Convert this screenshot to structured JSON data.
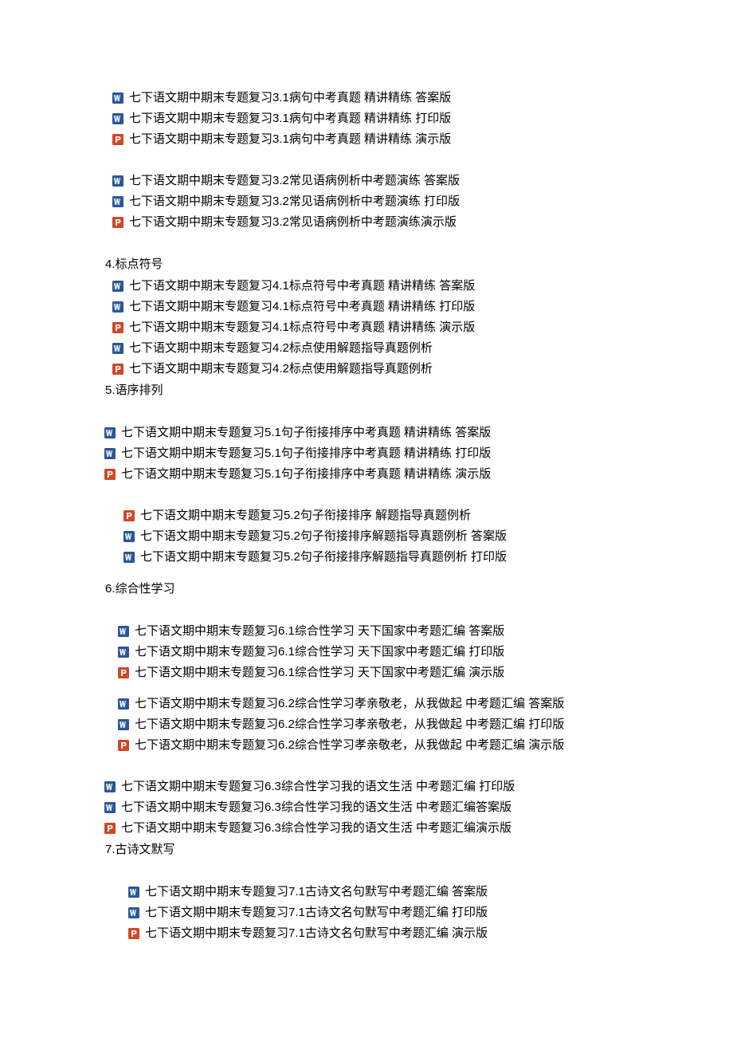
{
  "groups": [
    {
      "heading": null,
      "blocks": [
        {
          "indent": "indent-0",
          "items": [
            {
              "icon": "word",
              "text": "七下语文期中期末专题复习3.1病句中考真题 精讲精练 答案版"
            },
            {
              "icon": "word",
              "text": "七下语文期中期末专题复习3.1病句中考真题 精讲精练 打印版"
            },
            {
              "icon": "ppt",
              "text": "七下语文期中期末专题复习3.1病句中考真题 精讲精练 演示版"
            }
          ]
        },
        {
          "indent": "indent-0",
          "items": [
            {
              "icon": "word",
              "text": "七下语文期中期末专题复习3.2常见语病例析中考题演练 答案版"
            },
            {
              "icon": "word",
              "text": "七下语文期中期末专题复习3.2常见语病例析中考题演练 打印版"
            },
            {
              "icon": "ppt",
              "text": "七下语文期中期末专题复习3.2常见语病例析中考题演练演示版"
            }
          ]
        }
      ]
    },
    {
      "heading": "4.标点符号",
      "heading_indent": "heading-indent",
      "blocks": [
        {
          "indent": "indent-0",
          "items": [
            {
              "icon": "word",
              "text": "七下语文期中期末专题复习4.1标点符号中考真题 精讲精练 答案版"
            },
            {
              "icon": "word",
              "text": "七下语文期中期末专题复习4.1标点符号中考真题 精讲精练 打印版"
            },
            {
              "icon": "ppt",
              "text": "七下语文期中期末专题复习4.1标点符号中考真题 精讲精练 演示版"
            },
            {
              "icon": "word",
              "text": "七下语文期中期末专题复习4.2标点使用解题指导真题例析"
            },
            {
              "icon": "ppt",
              "text": "七下语文期中期末专题复习4.2标点使用解题指导真题例析"
            }
          ],
          "no_spacer_after": true
        }
      ]
    },
    {
      "heading": "5.语序排列",
      "heading_indent": "heading-indent",
      "blocks": [
        {
          "indent": "indent-neg",
          "spacer_before": true,
          "items": [
            {
              "icon": "word",
              "text": "七下语文期中期末专题复习5.1句子衔接排序中考真题 精讲精练 答案版"
            },
            {
              "icon": "word",
              "text": "七下语文期中期末专题复习5.1句子衔接排序中考真题 精讲精练 打印版"
            },
            {
              "icon": "ppt",
              "text": "七下语文期中期末专题复习5.1句子衔接排序中考真题 精讲精练 演示版"
            }
          ]
        },
        {
          "indent": "indent-2",
          "items": [
            {
              "icon": "ppt",
              "text": "七下语文期中期末专题复习5.2句子衔接排序 解题指导真题例析"
            },
            {
              "icon": "word",
              "text": "七下语文期中期末专题复习5.2句子衔接排序解题指导真题例析 答案版"
            },
            {
              "icon": "word",
              "text": "七下语文期中期末专题复习5.2句子衔接排序解题指导真题例析 打印版"
            }
          ],
          "spacer_after_small": true
        }
      ]
    },
    {
      "heading": "6.综合性学习",
      "heading_indent": "heading-indent",
      "blocks": [
        {
          "indent": "indent-1",
          "spacer_before": true,
          "items": [
            {
              "icon": "word",
              "text": "七下语文期中期末专题复习6.1综合性学习 天下国家中考题汇编 答案版"
            },
            {
              "icon": "word",
              "text": "七下语文期中期末专题复习6.1综合性学习 天下国家中考题汇编 打印版"
            },
            {
              "icon": "ppt",
              "text": "七下语文期中期末专题复习6.1综合性学习 天下国家中考题汇编 演示版"
            }
          ],
          "spacer_after_small": true
        },
        {
          "indent": "indent-1",
          "items": [
            {
              "icon": "word",
              "text": "七下语文期中期末专题复习6.2综合性学习孝亲敬老，从我做起 中考题汇编 答案版"
            },
            {
              "icon": "word",
              "text": "七下语文期中期末专题复习6.2综合性学习孝亲敬老，从我做起 中考题汇编 打印版"
            },
            {
              "icon": "ppt",
              "text": "七下语文期中期末专题复习6.2综合性学习孝亲敬老，从我做起 中考题汇编 演示版"
            }
          ]
        },
        {
          "indent": "indent-neg",
          "items": [
            {
              "icon": "word",
              "text": "七下语文期中期末专题复习6.3综合性学习我的语文生活 中考题汇编 打印版"
            },
            {
              "icon": "word",
              "text": "七下语文期中期末专题复习6.3综合性学习我的语文生活 中考题汇编答案版"
            },
            {
              "icon": "ppt",
              "text": "七下语文期中期末专题复习6.3综合性学习我的语文生活 中考题汇编演示版"
            }
          ],
          "no_spacer_after": true
        }
      ]
    },
    {
      "heading": "7.古诗文默写",
      "heading_indent": "heading-indent",
      "blocks": [
        {
          "indent": "indent-3",
          "spacer_before": true,
          "items": [
            {
              "icon": "word",
              "text": "七下语文期中期末专题复习7.1古诗文名句默写中考题汇编 答案版"
            },
            {
              "icon": "word",
              "text": "七下语文期中期末专题复习7.1古诗文名句默写中考题汇编 打印版"
            },
            {
              "icon": "ppt",
              "text": "七下语文期中期末专题复习7.1古诗文名句默写中考题汇编 演示版"
            }
          ]
        }
      ]
    }
  ]
}
